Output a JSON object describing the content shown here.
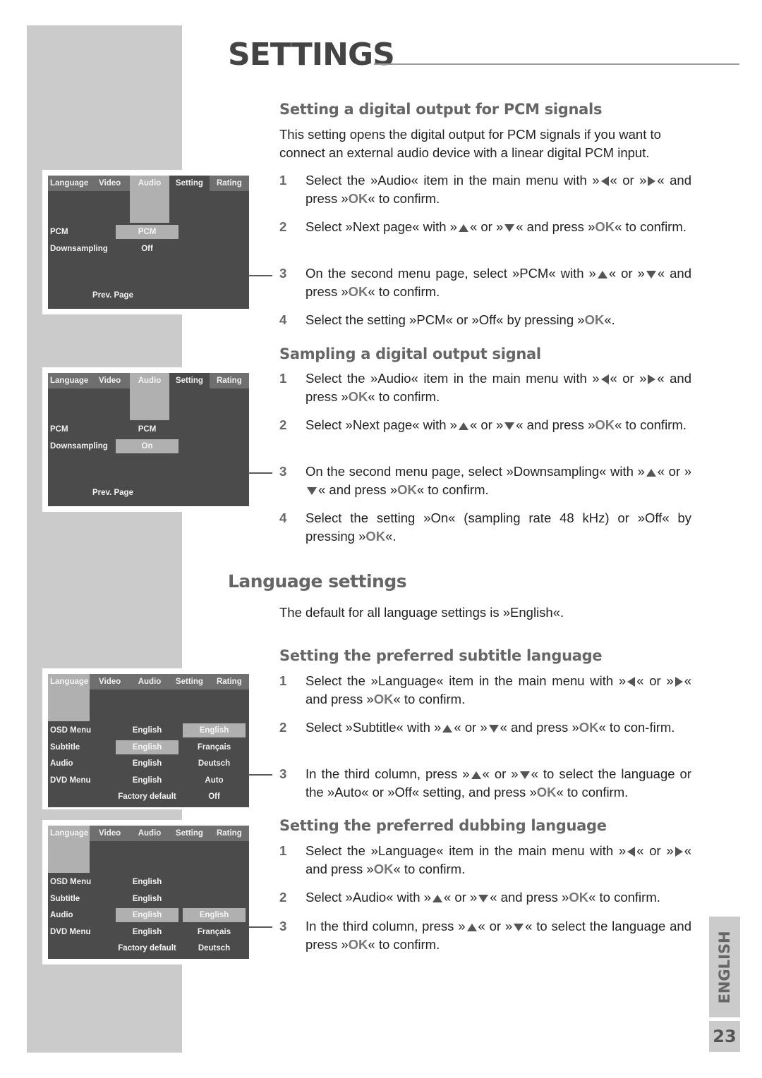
{
  "page": {
    "title": "SETTINGS",
    "page_number": "23",
    "language_tab": "ENGLISH"
  },
  "menus": {
    "tabs": [
      "Language",
      "Video",
      "Audio",
      "Setting",
      "Rating"
    ],
    "pcm_menu": {
      "selected_tab": "Audio",
      "rows": [
        {
          "label": "PCM",
          "value": "PCM",
          "highlighted": true
        },
        {
          "label": "Downsampling",
          "value": "Off",
          "highlighted": false
        }
      ],
      "footer": "Prev. Page"
    },
    "downsampling_menu": {
      "selected_tab": "Audio",
      "rows": [
        {
          "label": "PCM",
          "value": "PCM",
          "highlighted": false
        },
        {
          "label": "Downsampling",
          "value": "On",
          "highlighted": true
        }
      ],
      "footer": "Prev. Page"
    },
    "subtitle_menu": {
      "selected_tab": "Language",
      "rows": [
        {
          "label": "OSD Menu",
          "value": "English",
          "option": "English"
        },
        {
          "label": "Subtitle",
          "value": "English",
          "option": "Français"
        },
        {
          "label": "Audio",
          "value": "English",
          "option": "Deutsch"
        },
        {
          "label": "DVD Menu",
          "value": "English",
          "option": "Auto"
        },
        {
          "label": "",
          "value": "Factory default",
          "option": "Off"
        }
      ]
    },
    "dubbing_menu": {
      "selected_tab": "Language",
      "rows": [
        {
          "label": "OSD Menu",
          "value": "English",
          "option": ""
        },
        {
          "label": "Subtitle",
          "value": "English",
          "option": ""
        },
        {
          "label": "Audio",
          "value": "English",
          "option": "English"
        },
        {
          "label": "DVD Menu",
          "value": "English",
          "option": "Français"
        },
        {
          "label": "",
          "value": "Factory default",
          "option": "Deutsch"
        }
      ]
    }
  },
  "sections": {
    "pcm": {
      "heading": "Setting a digital output for PCM signals",
      "intro": "This setting opens the digital output for PCM signals if you want to connect an external audio device with a linear digital PCM input.",
      "steps": [
        {
          "n": "1",
          "parts": [
            "Select the »Audio« item in the main menu with »",
            "left",
            "« or »",
            "right",
            "« and press »",
            "OK",
            "« to confirm."
          ]
        },
        {
          "n": "2",
          "parts": [
            "Select »Next page« with »",
            "up",
            "« or »",
            "down",
            "« and press »",
            "OK",
            "« to confirm."
          ]
        },
        {
          "n": "3",
          "parts": [
            "On the second menu page, select »PCM« with »",
            "up",
            "« or »",
            "down",
            "« and press »",
            "OK",
            "« to confirm."
          ]
        },
        {
          "n": "4",
          "parts": [
            "Select the setting »PCM« or »Off« by pressing »",
            "OK",
            "«."
          ]
        }
      ]
    },
    "sampling": {
      "heading": "Sampling a digital output signal",
      "steps": [
        {
          "n": "1",
          "parts": [
            "Select the »Audio« item in the main menu with »",
            "left",
            "« or »",
            "right",
            "« and press »",
            "OK",
            "« to confirm."
          ]
        },
        {
          "n": "2",
          "parts": [
            "Select »Next page« with »",
            "up",
            "« or »",
            "down",
            "« and press »",
            "OK",
            "« to confirm."
          ]
        },
        {
          "n": "3",
          "parts": [
            "On the second menu page, select »Downsampling« with »",
            "up",
            "« or »",
            "down",
            "« and press »",
            "OK",
            "« to confirm."
          ]
        },
        {
          "n": "4",
          "parts": [
            "Select the setting »On« (sampling rate 48 kHz) or »Off« by pressing »",
            "OK",
            "«."
          ]
        }
      ]
    },
    "language": {
      "heading": "Language settings",
      "intro": "The default for all language settings is »English«."
    },
    "subtitle": {
      "heading": "Setting the preferred subtitle language",
      "steps": [
        {
          "n": "1",
          "parts": [
            "Select the »Language« item in the main menu with »",
            "left",
            "« or »",
            "right",
            "« and press »",
            "OK",
            "« to confirm."
          ]
        },
        {
          "n": "2",
          "parts": [
            "Select »Subtitle«  with »",
            "up",
            "« or »",
            "down",
            "« and press »",
            "OK",
            "« to con-firm."
          ]
        },
        {
          "n": "3",
          "parts": [
            "In the third column, press »",
            "up",
            "« or »",
            "down",
            "« to select the language or the »Auto« or »Off« setting, and press »",
            "OK",
            "« to confirm."
          ]
        }
      ]
    },
    "dubbing": {
      "heading": "Setting the preferred dubbing language",
      "steps": [
        {
          "n": "1",
          "parts": [
            "Select the »Language« item in the main menu with »",
            "left",
            "« or »",
            "right",
            "« and press »",
            "OK",
            "« to confirm."
          ]
        },
        {
          "n": "2",
          "parts": [
            "Select »Audio« with »",
            "up",
            "« or »",
            "down",
            "« and press »",
            "OK",
            "« to confirm."
          ]
        },
        {
          "n": "3",
          "parts": [
            "In the third column, press »",
            "up",
            "« or »",
            "down",
            "« to select the language and press »",
            "OK",
            "« to confirm."
          ]
        }
      ]
    }
  },
  "colors": {
    "sidebar": "#cbcbcb",
    "osd_background": "#4b4b4b",
    "osd_highlight": "#b0b0b0",
    "heading": "#666666"
  }
}
